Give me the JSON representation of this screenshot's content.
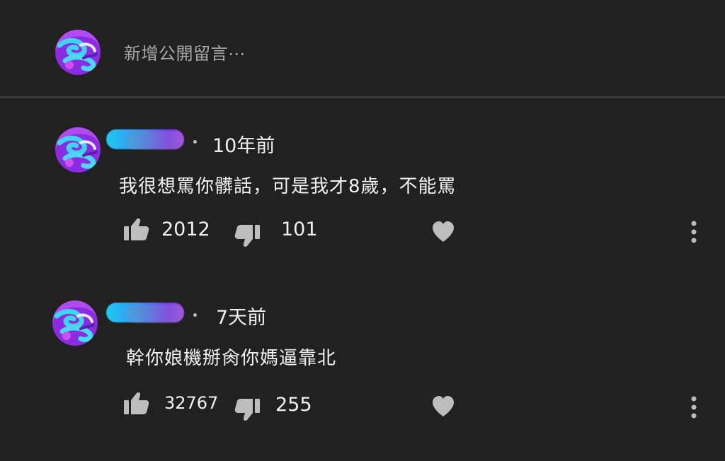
{
  "add_comment": {
    "placeholder": "新增公開留言⋯"
  },
  "comments": [
    {
      "time": "10年前",
      "text": "我很想罵你髒話，可是我才8歲，不能罵",
      "likes": "2012",
      "dislikes": "101"
    },
    {
      "time": "7天前",
      "text": "幹你娘機掰肏你媽逼靠北",
      "likes": "32767",
      "dislikes": "255"
    }
  ],
  "icons": {
    "like": "thumbs-up-icon",
    "dislike": "thumbs-down-icon",
    "heart": "heart-icon",
    "more": "more-vert-icon"
  },
  "colors": {
    "background": "#212121",
    "icon": "#bdbdbd",
    "divider": "#3a3a3a"
  }
}
